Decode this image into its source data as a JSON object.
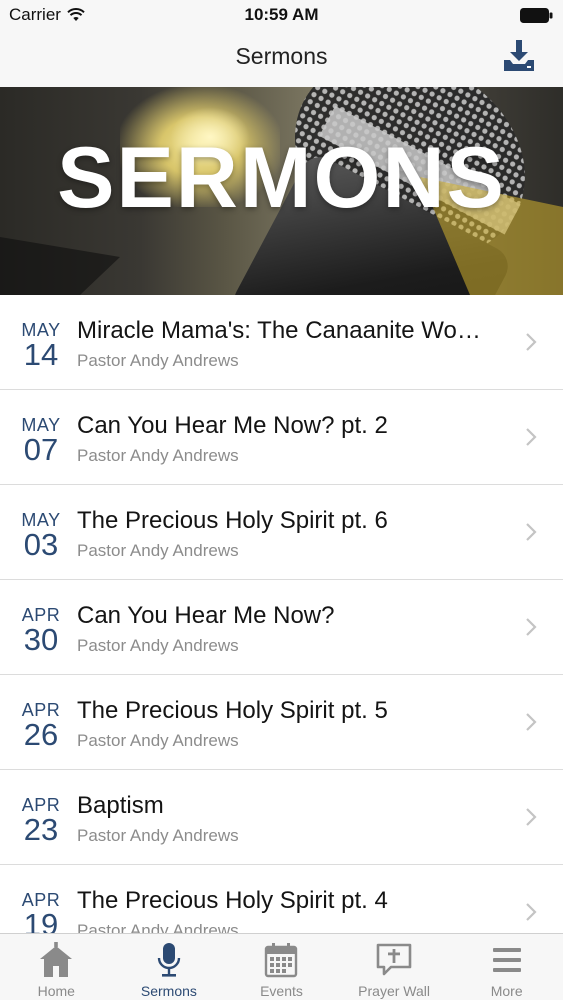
{
  "status_bar": {
    "carrier": "Carrier",
    "time": "10:59 AM"
  },
  "nav": {
    "title": "Sermons",
    "download_icon": "download-icon"
  },
  "hero": {
    "title": "SERMONS"
  },
  "sermons": [
    {
      "month": "MAY",
      "day": "14",
      "title": "Miracle Mama's: The Canaanite Wo…",
      "speaker": "Pastor Andy Andrews"
    },
    {
      "month": "MAY",
      "day": "07",
      "title": "Can You Hear Me Now? pt. 2",
      "speaker": "Pastor Andy Andrews"
    },
    {
      "month": "MAY",
      "day": "03",
      "title": "The Precious Holy Spirit pt. 6",
      "speaker": "Pastor Andy Andrews"
    },
    {
      "month": "APR",
      "day": "30",
      "title": "Can You Hear Me Now?",
      "speaker": "Pastor Andy Andrews"
    },
    {
      "month": "APR",
      "day": "26",
      "title": "The Precious Holy Spirit pt. 5",
      "speaker": "Pastor Andy Andrews"
    },
    {
      "month": "APR",
      "day": "23",
      "title": "Baptism",
      "speaker": "Pastor Andy Andrews"
    },
    {
      "month": "APR",
      "day": "19",
      "title": "The Precious Holy Spirit pt. 4",
      "speaker": "Pastor Andy Andrews"
    }
  ],
  "tabs": [
    {
      "label": "Home",
      "icon": "home-icon",
      "active": false
    },
    {
      "label": "Sermons",
      "icon": "microphone-icon",
      "active": true
    },
    {
      "label": "Events",
      "icon": "calendar-icon",
      "active": false
    },
    {
      "label": "Prayer Wall",
      "icon": "prayer-wall-icon",
      "active": false
    },
    {
      "label": "More",
      "icon": "menu-icon",
      "active": false
    }
  ],
  "colors": {
    "accent": "#2c4a73",
    "tab_inactive": "#8a8a8a",
    "bar_bg": "#f7f7f7"
  }
}
